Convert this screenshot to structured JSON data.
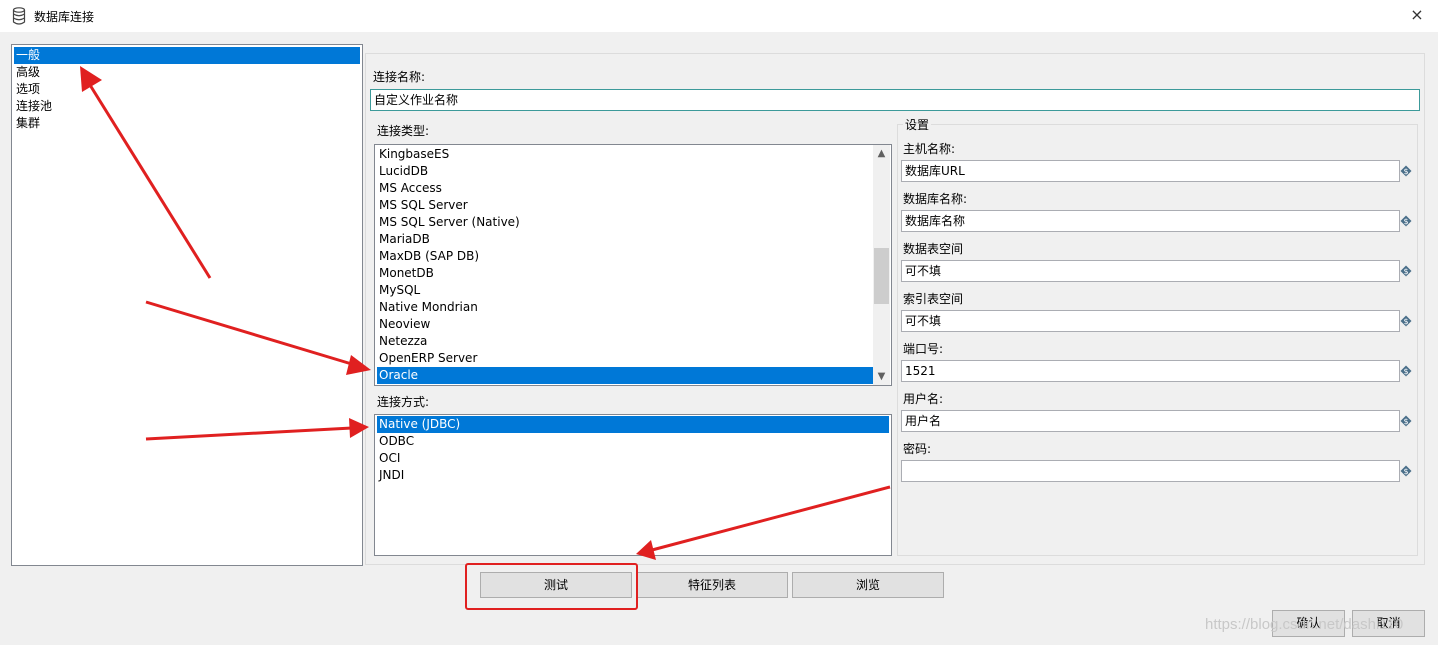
{
  "window": {
    "title": "数据库连接",
    "close_icon": "×"
  },
  "nav": {
    "items": [
      "一般",
      "高级",
      "选项",
      "连接池",
      "集群"
    ],
    "selected": 0
  },
  "connection_name": {
    "label": "连接名称:",
    "value": "自定义作业名称"
  },
  "connection_type": {
    "label": "连接类型:",
    "items": [
      "KingbaseES",
      "LucidDB",
      "MS Access",
      "MS SQL Server",
      "MS SQL Server (Native)",
      "MariaDB",
      "MaxDB (SAP DB)",
      "MonetDB",
      "MySQL",
      "Native Mondrian",
      "Neoview",
      "Netezza",
      "OpenERP Server",
      "Oracle"
    ],
    "selected": 13,
    "scroll_up_icon": "▲",
    "scroll_down_icon": "▼"
  },
  "access_method": {
    "label": "连接方式:",
    "items": [
      "Native (JDBC)",
      "ODBC",
      "OCI",
      "JNDI"
    ],
    "selected": 0
  },
  "settings": {
    "title": "设置",
    "fields": [
      {
        "label": "主机名称:",
        "value": "数据库URL"
      },
      {
        "label": "数据库名称:",
        "value": "数据库名称"
      },
      {
        "label": "数据表空间",
        "value": "可不填"
      },
      {
        "label": "索引表空间",
        "value": "可不填"
      },
      {
        "label": "端口号:",
        "value": "1521"
      },
      {
        "label": "用户名:",
        "value": "用户名"
      },
      {
        "label": "密码:",
        "value": ""
      }
    ],
    "variable_icon": "diamond-dollar-icon"
  },
  "buttons": {
    "test": "测试",
    "features": "特征列表",
    "browse": "浏览",
    "ok": "确认",
    "cancel": "取消"
  },
  "watermark": "https://blog.csdn.net/dashi110",
  "colors": {
    "selection": "#0078d7",
    "annotation": "#e02020",
    "field_border_focus": "#3c9a9a"
  }
}
